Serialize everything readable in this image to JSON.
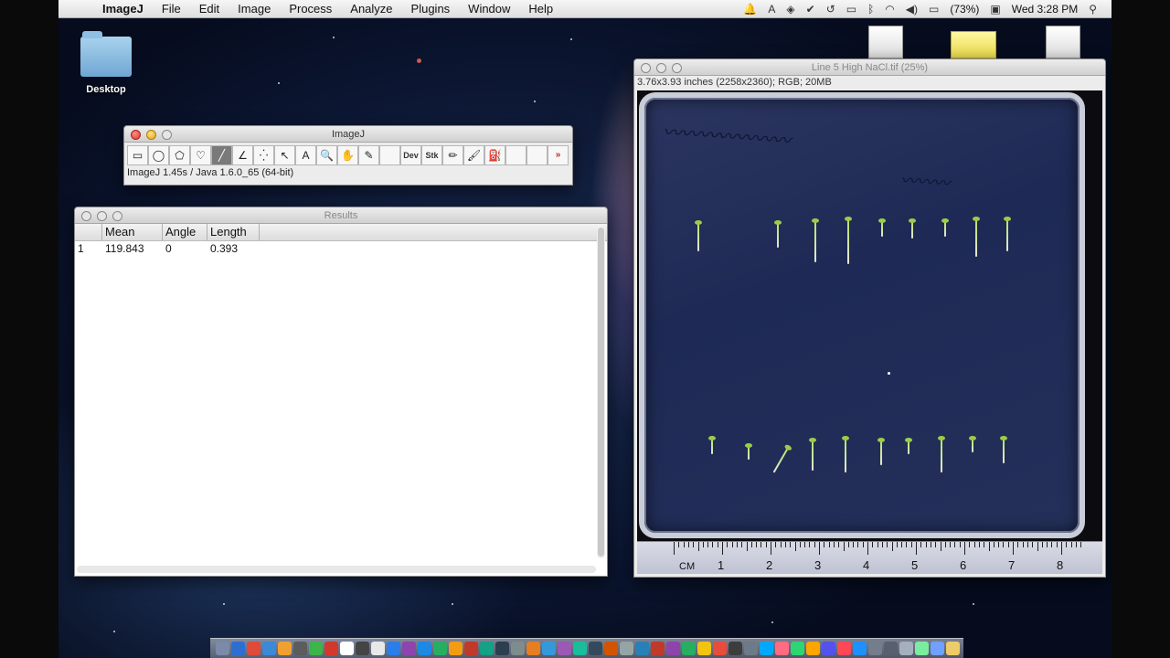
{
  "menubar": {
    "app_name": "ImageJ",
    "items": [
      "File",
      "Edit",
      "Image",
      "Process",
      "Analyze",
      "Plugins",
      "Window",
      "Help"
    ],
    "battery": "(73%)",
    "clock": "Wed 3:28 PM"
  },
  "desktop": {
    "folder_label": "Desktop"
  },
  "imagej_window": {
    "title": "ImageJ",
    "status": "ImageJ 1.45s / Java 1.6.0_65 (64-bit)",
    "tools": [
      {
        "name": "rectangle-tool",
        "glyph": "▭"
      },
      {
        "name": "oval-tool",
        "glyph": "◯"
      },
      {
        "name": "polygon-tool",
        "glyph": "⬠"
      },
      {
        "name": "freehand-tool",
        "glyph": "♡"
      },
      {
        "name": "line-tool",
        "glyph": "╱"
      },
      {
        "name": "angle-tool",
        "glyph": "∠"
      },
      {
        "name": "point-tool",
        "glyph": "⁛"
      },
      {
        "name": "wand-tool",
        "glyph": "↖"
      },
      {
        "name": "text-tool",
        "glyph": "A"
      },
      {
        "name": "zoom-tool",
        "glyph": "🔍"
      },
      {
        "name": "hand-tool",
        "glyph": "✋"
      },
      {
        "name": "dropper-tool",
        "glyph": "✎"
      },
      {
        "name": "blank-tool",
        "glyph": ""
      },
      {
        "name": "dev-menu-tool",
        "glyph": "Dev"
      },
      {
        "name": "stk-menu-tool",
        "glyph": "Stk"
      },
      {
        "name": "pencil-tool",
        "glyph": "✏"
      },
      {
        "name": "brush-tool",
        "glyph": "🖌"
      },
      {
        "name": "flood-fill-tool",
        "glyph": "⛽"
      },
      {
        "name": "blank-tool-2",
        "glyph": ""
      },
      {
        "name": "blank-tool-3",
        "glyph": ""
      },
      {
        "name": "more-tools",
        "glyph": "»"
      }
    ]
  },
  "results_window": {
    "title": "Results",
    "columns": [
      "",
      "Mean",
      "Angle",
      "Length"
    ],
    "rows": [
      [
        "1",
        "119.843",
        "0",
        "0.393"
      ]
    ]
  },
  "image_window": {
    "title": "Line 5 High NaCl.tif (25%)",
    "info": "3.76x3.93 inches (2258x2360); RGB; 20MB",
    "ruler_unit": "CM",
    "ruler_numbers": [
      "1",
      "2",
      "3",
      "4",
      "5",
      "6",
      "7",
      "8"
    ]
  }
}
